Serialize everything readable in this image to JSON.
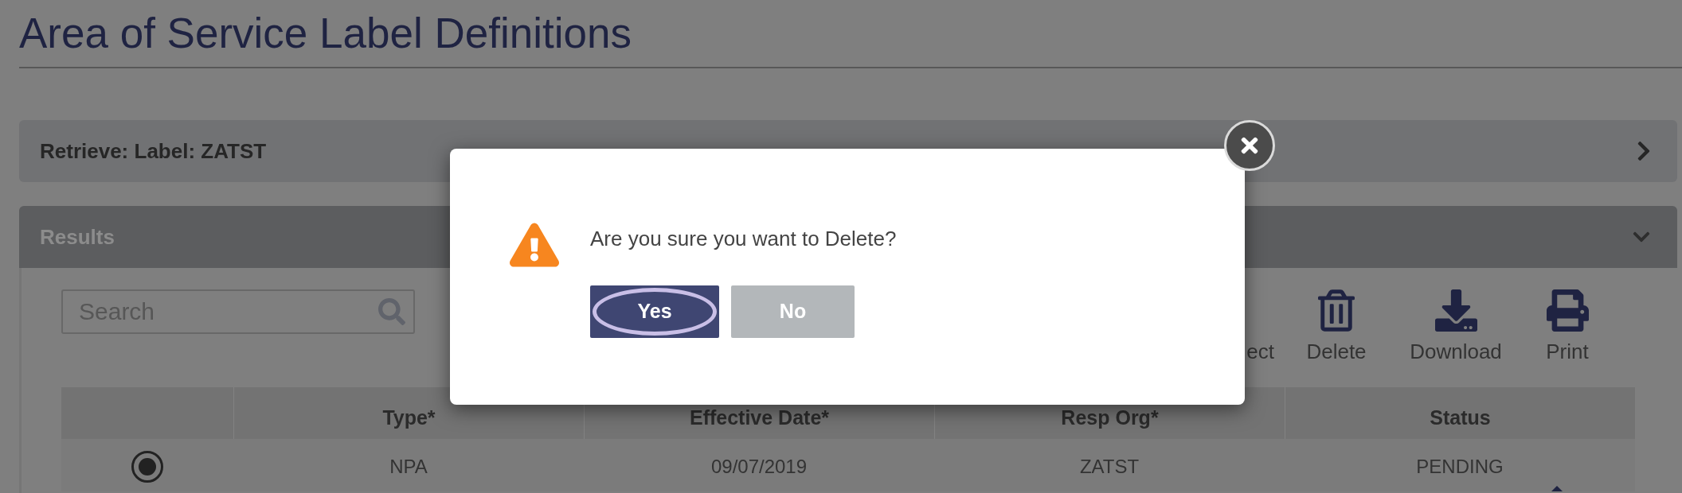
{
  "page": {
    "title": "Area of Service Label Definitions"
  },
  "retrieve_panel": {
    "title": "Retrieve: Label: ZATST",
    "expanded": false
  },
  "results_panel": {
    "title": "Results",
    "expanded": true,
    "search": {
      "placeholder": "Search"
    },
    "toolbar": [
      {
        "label": "ect",
        "kind": "covered"
      },
      {
        "label": "Delete",
        "kind": "delete"
      },
      {
        "label": "Download",
        "kind": "download"
      },
      {
        "label": "Print",
        "kind": "print"
      }
    ],
    "table": {
      "columns": [
        "Type*",
        "Effective Date*",
        "Resp Org*",
        "Status"
      ],
      "rows": [
        {
          "selected": true,
          "cells": [
            "NPA",
            "09/07/2019",
            "ZATST",
            "PENDING"
          ]
        }
      ]
    }
  },
  "dialog": {
    "message": "Are you sure you want to Delete?",
    "buttons": [
      {
        "label": "Yes",
        "kind": "primary",
        "focused": true
      },
      {
        "label": "No",
        "kind": "secondary",
        "focused": false
      }
    ]
  }
}
